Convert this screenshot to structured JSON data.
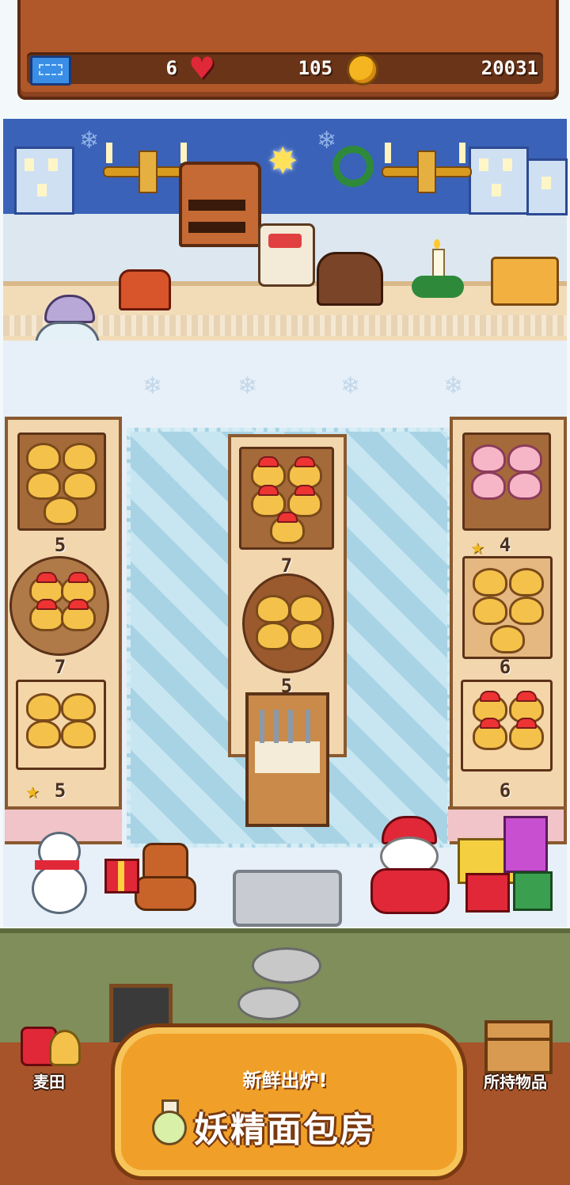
{
  "stats": {
    "tickets": "6",
    "hearts": "105",
    "coins": "20031"
  },
  "icons": {
    "ticket": "ticket-icon",
    "heart": "heart-icon",
    "coin": "coin-icon"
  },
  "shelves": {
    "left": [
      {
        "count": "5",
        "star": false
      },
      {
        "count": "7",
        "star": false
      },
      {
        "count": "5",
        "star": true
      }
    ],
    "center": [
      {
        "count": "7",
        "star": false
      },
      {
        "count": "5",
        "star": false
      }
    ],
    "right": [
      {
        "count": "4",
        "star": true
      },
      {
        "count": "6",
        "star": false
      },
      {
        "count": "6",
        "star": false
      }
    ]
  },
  "nav": {
    "left_label": "麦田",
    "right_label": "所持物品",
    "main_subtitle": "新鲜出炉!",
    "main_title": "妖精面包房"
  },
  "colors": {
    "wood": "#b0582a",
    "button": "#f0a028",
    "accent_red": "#e03030"
  }
}
